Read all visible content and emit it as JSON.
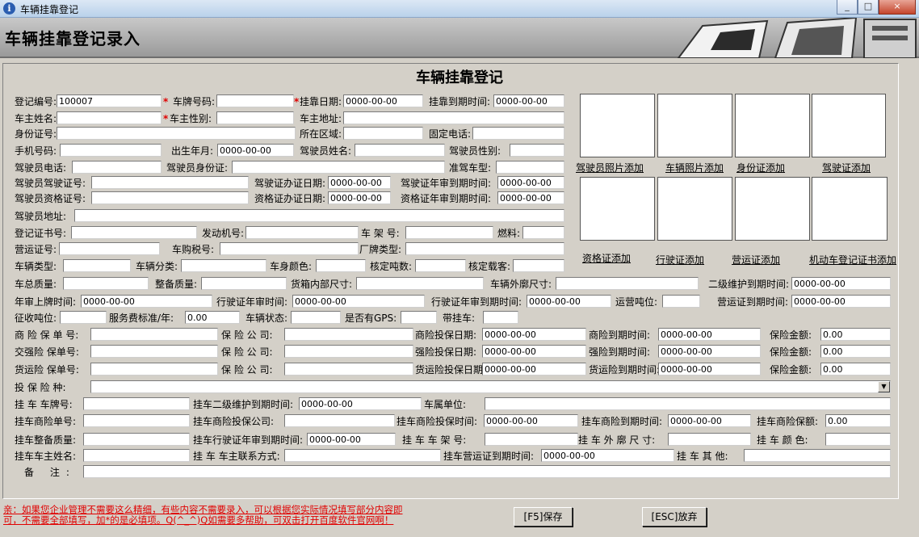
{
  "window": {
    "title": "车辆挂靠登记",
    "controls": [
      "_",
      "□",
      "×"
    ]
  },
  "banner": {
    "title": "车辆挂靠登记录入"
  },
  "form_title": "车辆挂靠登记",
  "row1": {
    "reg_no_label": "登记编号:",
    "reg_no": "100007",
    "plate_label": "车牌号码:",
    "plate": "",
    "attach_date_label": "挂靠日期:",
    "attach_date": "0000-00-00",
    "attach_expire_label": "挂靠到期时间:",
    "attach_expire": "0000-00-00"
  },
  "row2": {
    "owner_name_label": "车主姓名:",
    "owner_gender_label": "车主性别:",
    "owner_addr_label": "车主地址:"
  },
  "row3": {
    "id_no_label": "身份证号:",
    "area_label": "所在区域:",
    "phone_label": "固定电话:"
  },
  "row4": {
    "mobile_label": "手机号码:",
    "birth_label": "出生年月:",
    "birth": "0000-00-00",
    "driver_name_label": "驾驶员姓名:",
    "driver_gender_label": "驾驶员性别:"
  },
  "row5": {
    "driver_tel_label": "驾驶员电话:",
    "driver_id_label": "驾驶员身份证:",
    "vehicle_type_label": "准驾车型:"
  },
  "row6": {
    "license_no_label": "驾驶员驾驶证号:",
    "license_issue_label": "驾驶证办证日期:",
    "license_issue": "0000-00-00",
    "license_review_label": "驾驶证年审到期时间:",
    "license_review": "0000-00-00"
  },
  "row7": {
    "qual_no_label": "驾驶员资格证号:",
    "qual_issue_label": "资格证办证日期:",
    "qual_issue": "0000-00-00",
    "qual_review_label": "资格证年审到期时间:",
    "qual_review": "0000-00-00"
  },
  "row8": {
    "driver_addr_label": "驾驶员地址:"
  },
  "row9": {
    "reg_cert_label": "登记证书号:",
    "engine_label": "发动机号:",
    "frame_label": "车 架 号:",
    "fuel_label": "燃料:"
  },
  "row10": {
    "op_cert_label": "营运证号:",
    "purchase_tax_label": "车购税号:",
    "brand_label": "厂牌类型:"
  },
  "row11": {
    "veh_type_label": "车辆类型:",
    "veh_class_label": "车辆分类:",
    "color_label": "车身颜色:",
    "tonnage_label": "核定吨数:",
    "passengers_label": "核定载客:"
  },
  "row12": {
    "gross_label": "车总质量:",
    "curb_label": "整备质量:",
    "cargo_label": "货箱内部尺寸:",
    "outer_label": "车辆外廓尺寸:",
    "maint_label": "二级维护到期时间:",
    "maint": "0000-00-00"
  },
  "row13": {
    "first_reg_label": "年审上牌时间:",
    "first_reg": "0000-00-00",
    "lic_review_label": "行驶证年审时间:",
    "lic_review": "0000-00-00",
    "lic_expire_label": "行驶证年审到期时间:",
    "lic_expire": "0000-00-00",
    "op_ton_label": "运营吨位:",
    "op_expire_label": "营运证到期时间:",
    "op_expire": "0000-00-00"
  },
  "row14": {
    "levy_label": "征收吨位:",
    "fee_label": "服务费标准/年:",
    "fee": "0.00",
    "status_label": "车辆状态:",
    "gps_label": "是否有GPS:",
    "trailer_label": "带挂车:"
  },
  "ins1": {
    "no_label": "商 险 保 单 号:",
    "company_label": "保 险 公 司:",
    "start_label": "商险投保日期:",
    "start": "0000-00-00",
    "end_label": "商险到期时间:",
    "end": "0000-00-00",
    "amount_label": "保险金额:",
    "amount": "0.00"
  },
  "ins2": {
    "no_label": "交强险 保单号:",
    "company_label": "保 险 公 司:",
    "start_label": "强险投保日期:",
    "start": "0000-00-00",
    "end_label": "强险到期时间:",
    "end": "0000-00-00",
    "amount_label": "保险金额:",
    "amount": "0.00"
  },
  "ins3": {
    "no_label": "货运险 保单号:",
    "company_label": "保 险 公 司:",
    "start_label": "货运险投保日期",
    "start": "0000-00-00",
    "end_label": "货运险到期时间:",
    "end": "0000-00-00",
    "amount_label": "保险金额:",
    "amount": "0.00"
  },
  "ins_type_label": "投 保 险 种:",
  "tr1": {
    "plate_label": "挂 车 车牌号:",
    "maint_label": "挂车二级维护到期时间:",
    "maint": "0000-00-00",
    "owner_unit_label": "车属单位:"
  },
  "tr2": {
    "ins_no_label": "挂车商险单号:",
    "ins_co_label": "挂车商险投保公司:",
    "ins_start_label": "挂车商险投保时间:",
    "ins_start": "0000-00-00",
    "ins_end_label": "挂车商险到期时间:",
    "ins_end": "0000-00-00",
    "ins_amount_label": "挂车商险保额:",
    "ins_amount": "0.00"
  },
  "tr3": {
    "curb_label": "挂车整备质量:",
    "lic_label": "挂车行驶证年审到期时间:",
    "lic": "0000-00-00",
    "frame_label": "挂 车 车 架 号:",
    "outer_label": "挂 车 外 廓 尺 寸:",
    "color_label": "挂 车 颜 色:"
  },
  "tr4": {
    "owner_label": "挂车车主姓名:",
    "contact_label": "挂 车 车主联系方式:",
    "op_label": "挂车营运证到期时间:",
    "op": "0000-00-00",
    "other_label": "挂 车 其 他:"
  },
  "remark_label": "备 注:",
  "photos": {
    "top": [
      "驾驶员照片添加",
      "车辆照片添加",
      "身份证添加",
      "驾驶证添加"
    ],
    "bottom": [
      "资格证添加",
      "行驶证添加",
      "营运证添加",
      "机动车登记证书添加"
    ]
  },
  "notes": [
    "亲：如果您企业管理不需要这么精细，有些内容不需要录入，可以根据您实际情况填写部分内容即",
    "可，不需要全部填写，加*的是必填项。Q(^_^)Q如需要多帮助，可双击打开百度软件官网啊！"
  ],
  "buttons": {
    "save": "[F5]保存",
    "cancel": "[ESC]放弃"
  },
  "colors": {
    "required_mark": "#e00000",
    "note_text": "#e00000",
    "form_bg": "#d4d0c8"
  }
}
